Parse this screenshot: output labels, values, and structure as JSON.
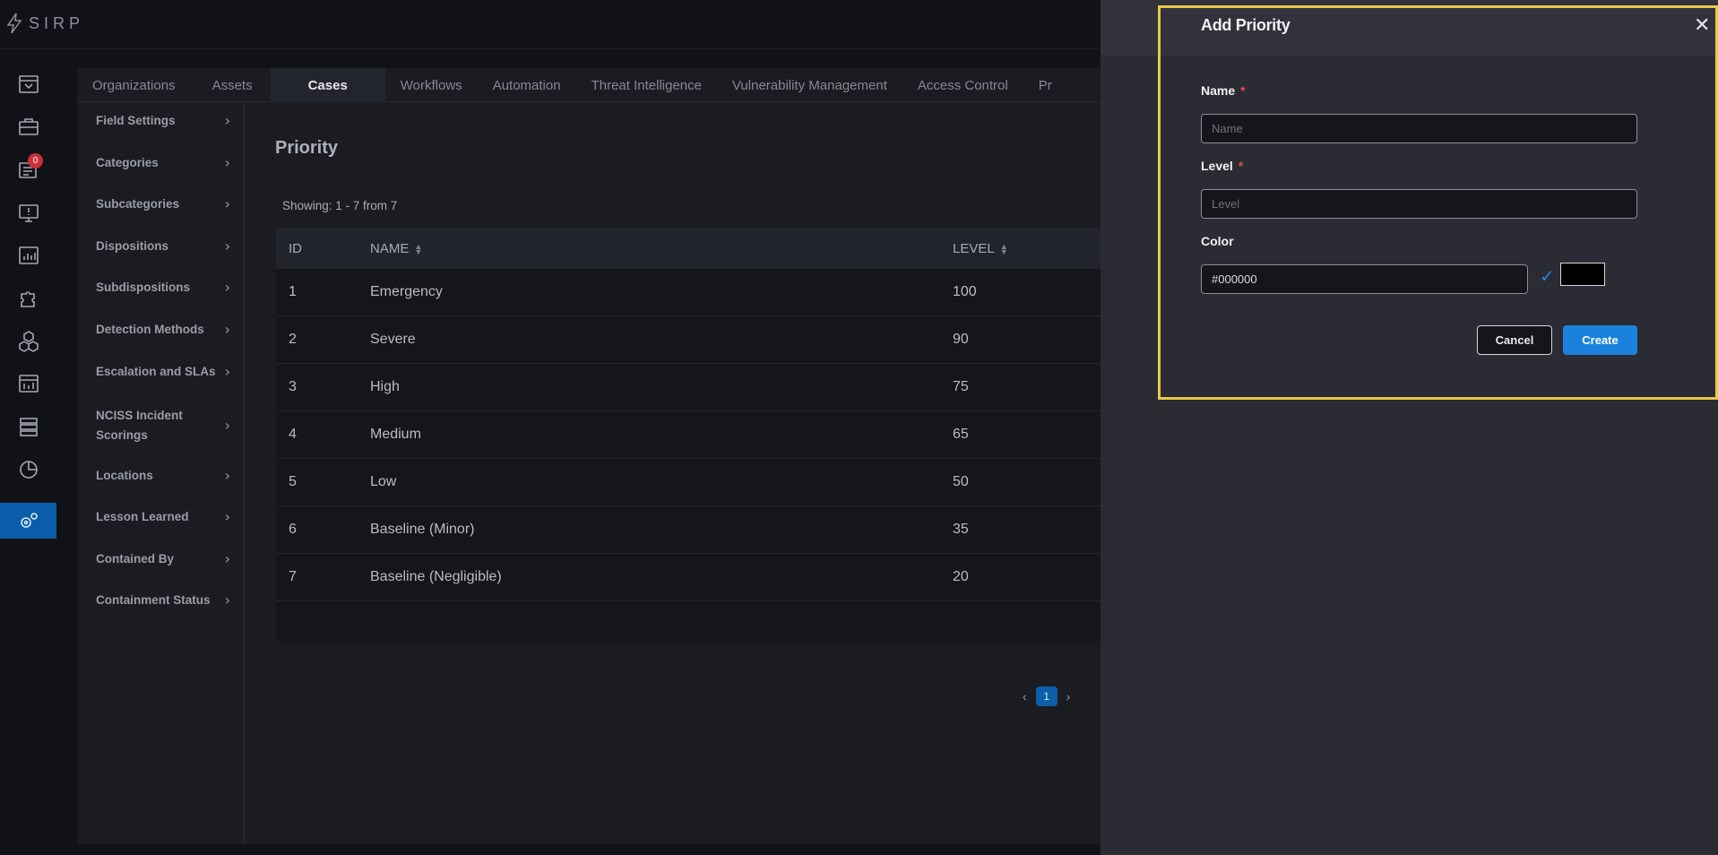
{
  "app": {
    "logo_text": "SIRP"
  },
  "rail": {
    "notification_count": "0"
  },
  "tabs": [
    "Organizations",
    "Assets",
    "Cases",
    "Workflows",
    "Automation",
    "Threat Intelligence",
    "Vulnerability Management",
    "Access Control",
    "Pr"
  ],
  "subnav": [
    "Field Settings",
    "Categories",
    "Subcategories",
    "Dispositions",
    "Subdispositions",
    "Detection Methods",
    "Escalation and SLAs",
    "NCISS Incident Scorings",
    "Locations",
    "Lesson Learned",
    "Contained By",
    "Containment Status"
  ],
  "main": {
    "title": "Priority",
    "showing": "Showing: 1 - 7 from 7",
    "columns": {
      "id": "ID",
      "name": "NAME",
      "level": "LEVEL"
    },
    "rows": [
      {
        "id": "1",
        "name": "Emergency",
        "level": "100"
      },
      {
        "id": "2",
        "name": "Severe",
        "level": "90"
      },
      {
        "id": "3",
        "name": "High",
        "level": "75"
      },
      {
        "id": "4",
        "name": "Medium",
        "level": "65"
      },
      {
        "id": "5",
        "name": "Low",
        "level": "50"
      },
      {
        "id": "6",
        "name": "Baseline (Minor)",
        "level": "35"
      },
      {
        "id": "7",
        "name": "Baseline (Negligible)",
        "level": "20"
      }
    ],
    "pager": {
      "current": "1"
    }
  },
  "dialog": {
    "title": "Add Priority",
    "close": "✕",
    "name_label": "Name",
    "name_placeholder": "Name",
    "level_label": "Level",
    "level_placeholder": "Level",
    "color_label": "Color",
    "color_value": "#000000",
    "required_mark": "*",
    "cancel_label": "Cancel",
    "create_label": "Create"
  },
  "colors": {
    "accent": "#1a82dc",
    "highlight_frame": "#e7c84a",
    "swatch": "#000000"
  }
}
